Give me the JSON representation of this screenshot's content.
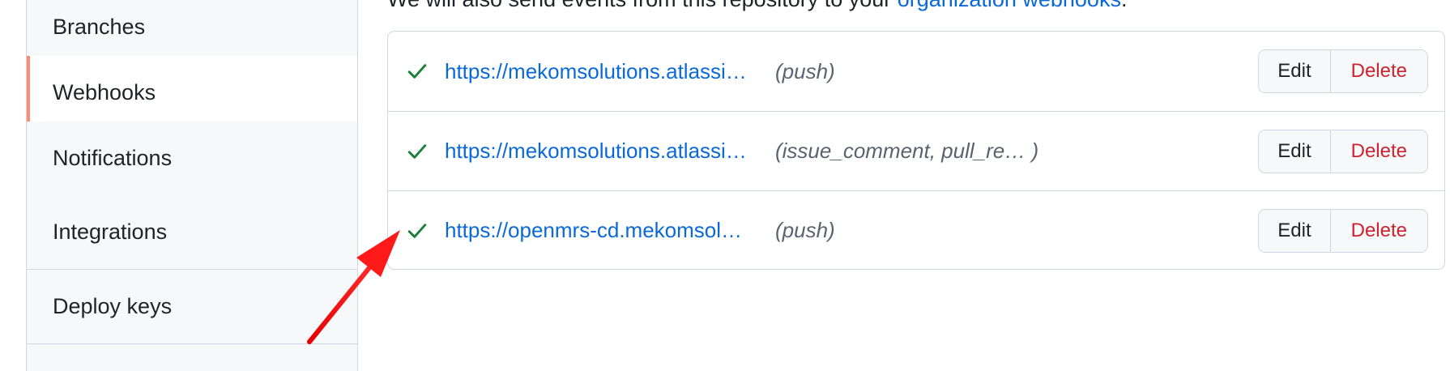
{
  "sidebar": {
    "items": [
      {
        "label": "Branches",
        "selected": false
      },
      {
        "label": "Webhooks",
        "selected": true
      },
      {
        "label": "Notifications",
        "selected": false
      },
      {
        "label": "Integrations",
        "selected": false
      },
      {
        "label": "Deploy keys",
        "selected": false
      }
    ]
  },
  "intro": {
    "text": "We will also send events from this repository to your ",
    "link_label": "organization webhooks",
    "suffix": "."
  },
  "webhooks": [
    {
      "url": "https://mekomsolutions.atlassi…",
      "events": "(push)",
      "status_icon": "check-icon",
      "edit_label": "Edit",
      "delete_label": "Delete"
    },
    {
      "url": "https://mekomsolutions.atlassi…",
      "events": "(issue_comment, pull_re… )",
      "status_icon": "check-icon",
      "edit_label": "Edit",
      "delete_label": "Delete"
    },
    {
      "url": "https://openmrs-cd.mekomsol…",
      "events": "(push)",
      "status_icon": "check-icon",
      "edit_label": "Edit",
      "delete_label": "Delete"
    }
  ],
  "colors": {
    "link": "#0969da",
    "success": "#1a7f37",
    "danger": "#cf222e",
    "selected_accent": "#fd8c73",
    "annotation_arrow": "#ff1a1a"
  }
}
